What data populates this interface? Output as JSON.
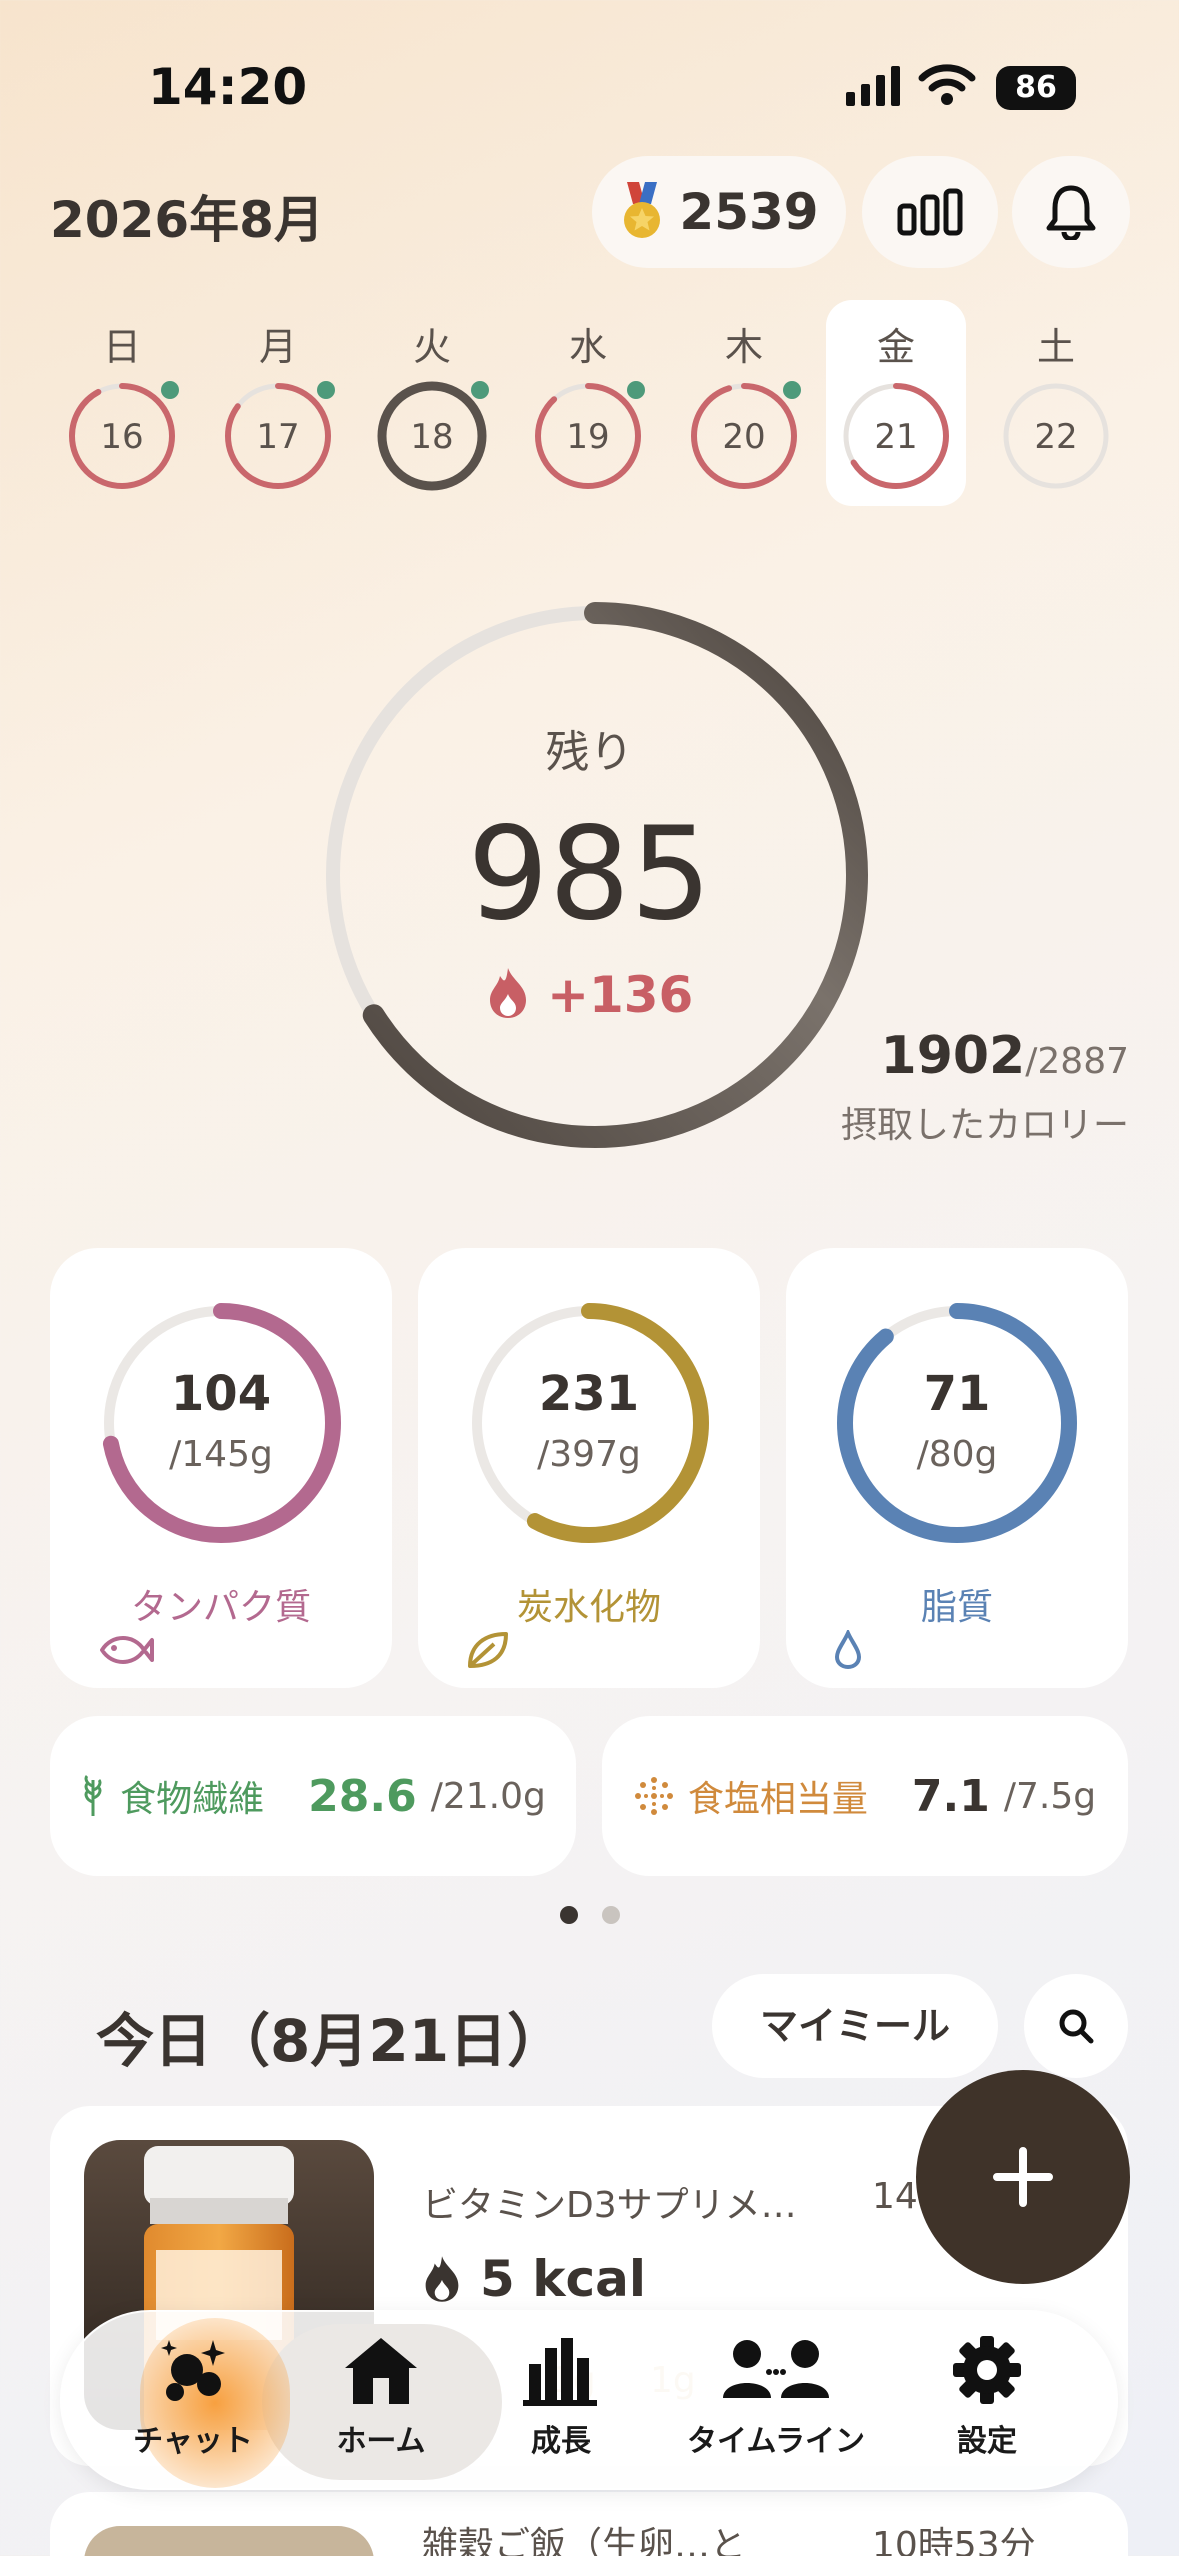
{
  "status_bar": {
    "time": "14:20",
    "battery": "86"
  },
  "header": {
    "month": "2026年8月",
    "coins": "2539"
  },
  "week": [
    {
      "weekday": "日",
      "date": "16",
      "progress": 0.92,
      "dot": true,
      "state": "past"
    },
    {
      "weekday": "月",
      "date": "17",
      "progress": 0.85,
      "dot": true,
      "state": "past"
    },
    {
      "weekday": "火",
      "date": "18",
      "progress": 1.0,
      "dot": true,
      "state": "over"
    },
    {
      "weekday": "水",
      "date": "19",
      "progress": 0.88,
      "dot": true,
      "state": "past"
    },
    {
      "weekday": "木",
      "date": "20",
      "progress": 0.95,
      "dot": true,
      "state": "past"
    },
    {
      "weekday": "金",
      "date": "21",
      "progress": 0.66,
      "dot": false,
      "state": "selected"
    },
    {
      "weekday": "土",
      "date": "22",
      "progress": 0,
      "dot": false,
      "state": "future"
    }
  ],
  "calories": {
    "remaining_label": "残り",
    "remaining": "985",
    "burned": "+136",
    "intake": "1902",
    "goal": "/2887",
    "intake_label": "摂取したカロリー",
    "progress": 0.66
  },
  "macros": [
    {
      "value": "104",
      "goal": "/145g",
      "label": "タンパク質",
      "progress": 0.72,
      "color": "#b3698f",
      "icon": "fish-icon"
    },
    {
      "value": "231",
      "goal": "/397g",
      "label": "炭水化物",
      "progress": 0.58,
      "color": "#b39336",
      "icon": "leaf-icon"
    },
    {
      "value": "71",
      "goal": "/80g",
      "label": "脂質",
      "progress": 0.89,
      "color": "#5a82b4",
      "icon": "drop-icon"
    }
  ],
  "extra": [
    {
      "label": "食物繊維",
      "value": "28.6",
      "goal": "/21.0g",
      "color": "#4e9a5e",
      "icon": "wheat-icon"
    },
    {
      "label": "食塩相当量",
      "value": "7.1",
      "goal": "/7.5g",
      "color": "#d08a3c",
      "icon": "salt-icon"
    }
  ],
  "today": {
    "title": "今日（8月21日）",
    "my_meal": "マイミール"
  },
  "meals": [
    {
      "name": "ビタミンD3サプリメ…",
      "time": "14",
      "kcal": "5 kcal",
      "macros": "1g",
      "macros2": "1g"
    },
    {
      "name": "雑穀ご飯（生卵…と",
      "time": "10時53分"
    }
  ],
  "tabs": [
    {
      "label": "チャット",
      "icon": "chat-sparkle-icon"
    },
    {
      "label": "ホーム",
      "icon": "home-icon"
    },
    {
      "label": "成長",
      "icon": "bar-chart-icon"
    },
    {
      "label": "タイムライン",
      "icon": "people-icon"
    },
    {
      "label": "設定",
      "icon": "gear-icon"
    }
  ]
}
